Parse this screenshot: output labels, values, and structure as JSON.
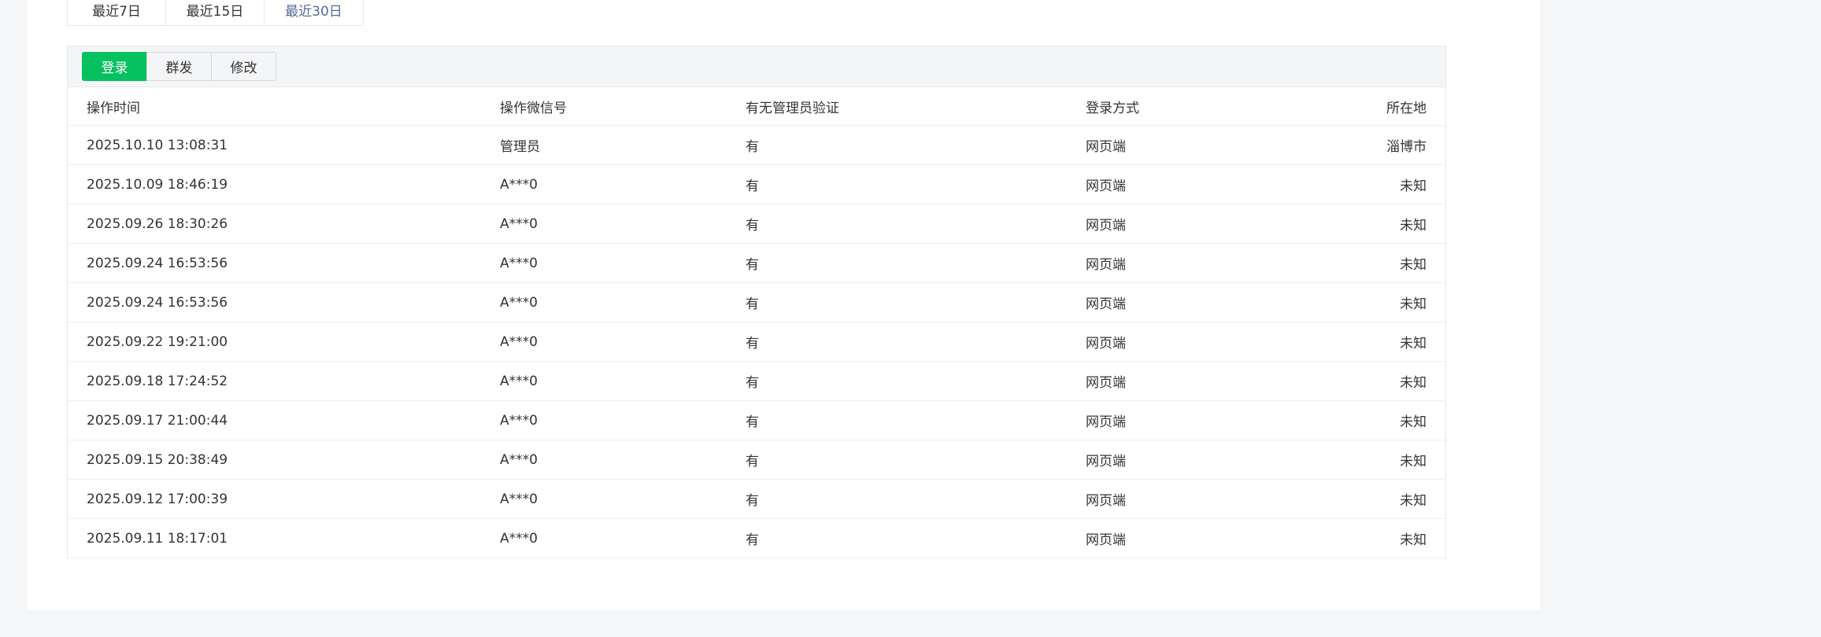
{
  "range_tabs": [
    {
      "label": "最近7日",
      "active": false
    },
    {
      "label": "最近15日",
      "active": false
    },
    {
      "label": "最近30日",
      "active": true
    }
  ],
  "type_buttons": [
    {
      "label": "登录",
      "active": true
    },
    {
      "label": "群发",
      "active": false
    },
    {
      "label": "修改",
      "active": false
    }
  ],
  "table": {
    "columns": [
      "操作时间",
      "操作微信号",
      "有无管理员验证",
      "登录方式",
      "所在地"
    ],
    "rows": [
      [
        "2025.10.10 13:08:31",
        "管理员",
        "有",
        "网页端",
        "淄博市"
      ],
      [
        "2025.10.09 18:46:19",
        "A***0",
        "有",
        "网页端",
        "未知"
      ],
      [
        "2025.09.26 18:30:26",
        "A***0",
        "有",
        "网页端",
        "未知"
      ],
      [
        "2025.09.24 16:53:56",
        "A***0",
        "有",
        "网页端",
        "未知"
      ],
      [
        "2025.09.24 16:53:56",
        "A***0",
        "有",
        "网页端",
        "未知"
      ],
      [
        "2025.09.22 19:21:00",
        "A***0",
        "有",
        "网页端",
        "未知"
      ],
      [
        "2025.09.18 17:24:52",
        "A***0",
        "有",
        "网页端",
        "未知"
      ],
      [
        "2025.09.17 21:00:44",
        "A***0",
        "有",
        "网页端",
        "未知"
      ],
      [
        "2025.09.15 20:38:49",
        "A***0",
        "有",
        "网页端",
        "未知"
      ],
      [
        "2025.09.12 17:00:39",
        "A***0",
        "有",
        "网页端",
        "未知"
      ],
      [
        "2025.09.11 18:17:01",
        "A***0",
        "有",
        "网页端",
        "未知"
      ]
    ]
  },
  "colors": {
    "accent": "#07c160",
    "link": "#576b95",
    "background": "#f5f6f8"
  }
}
